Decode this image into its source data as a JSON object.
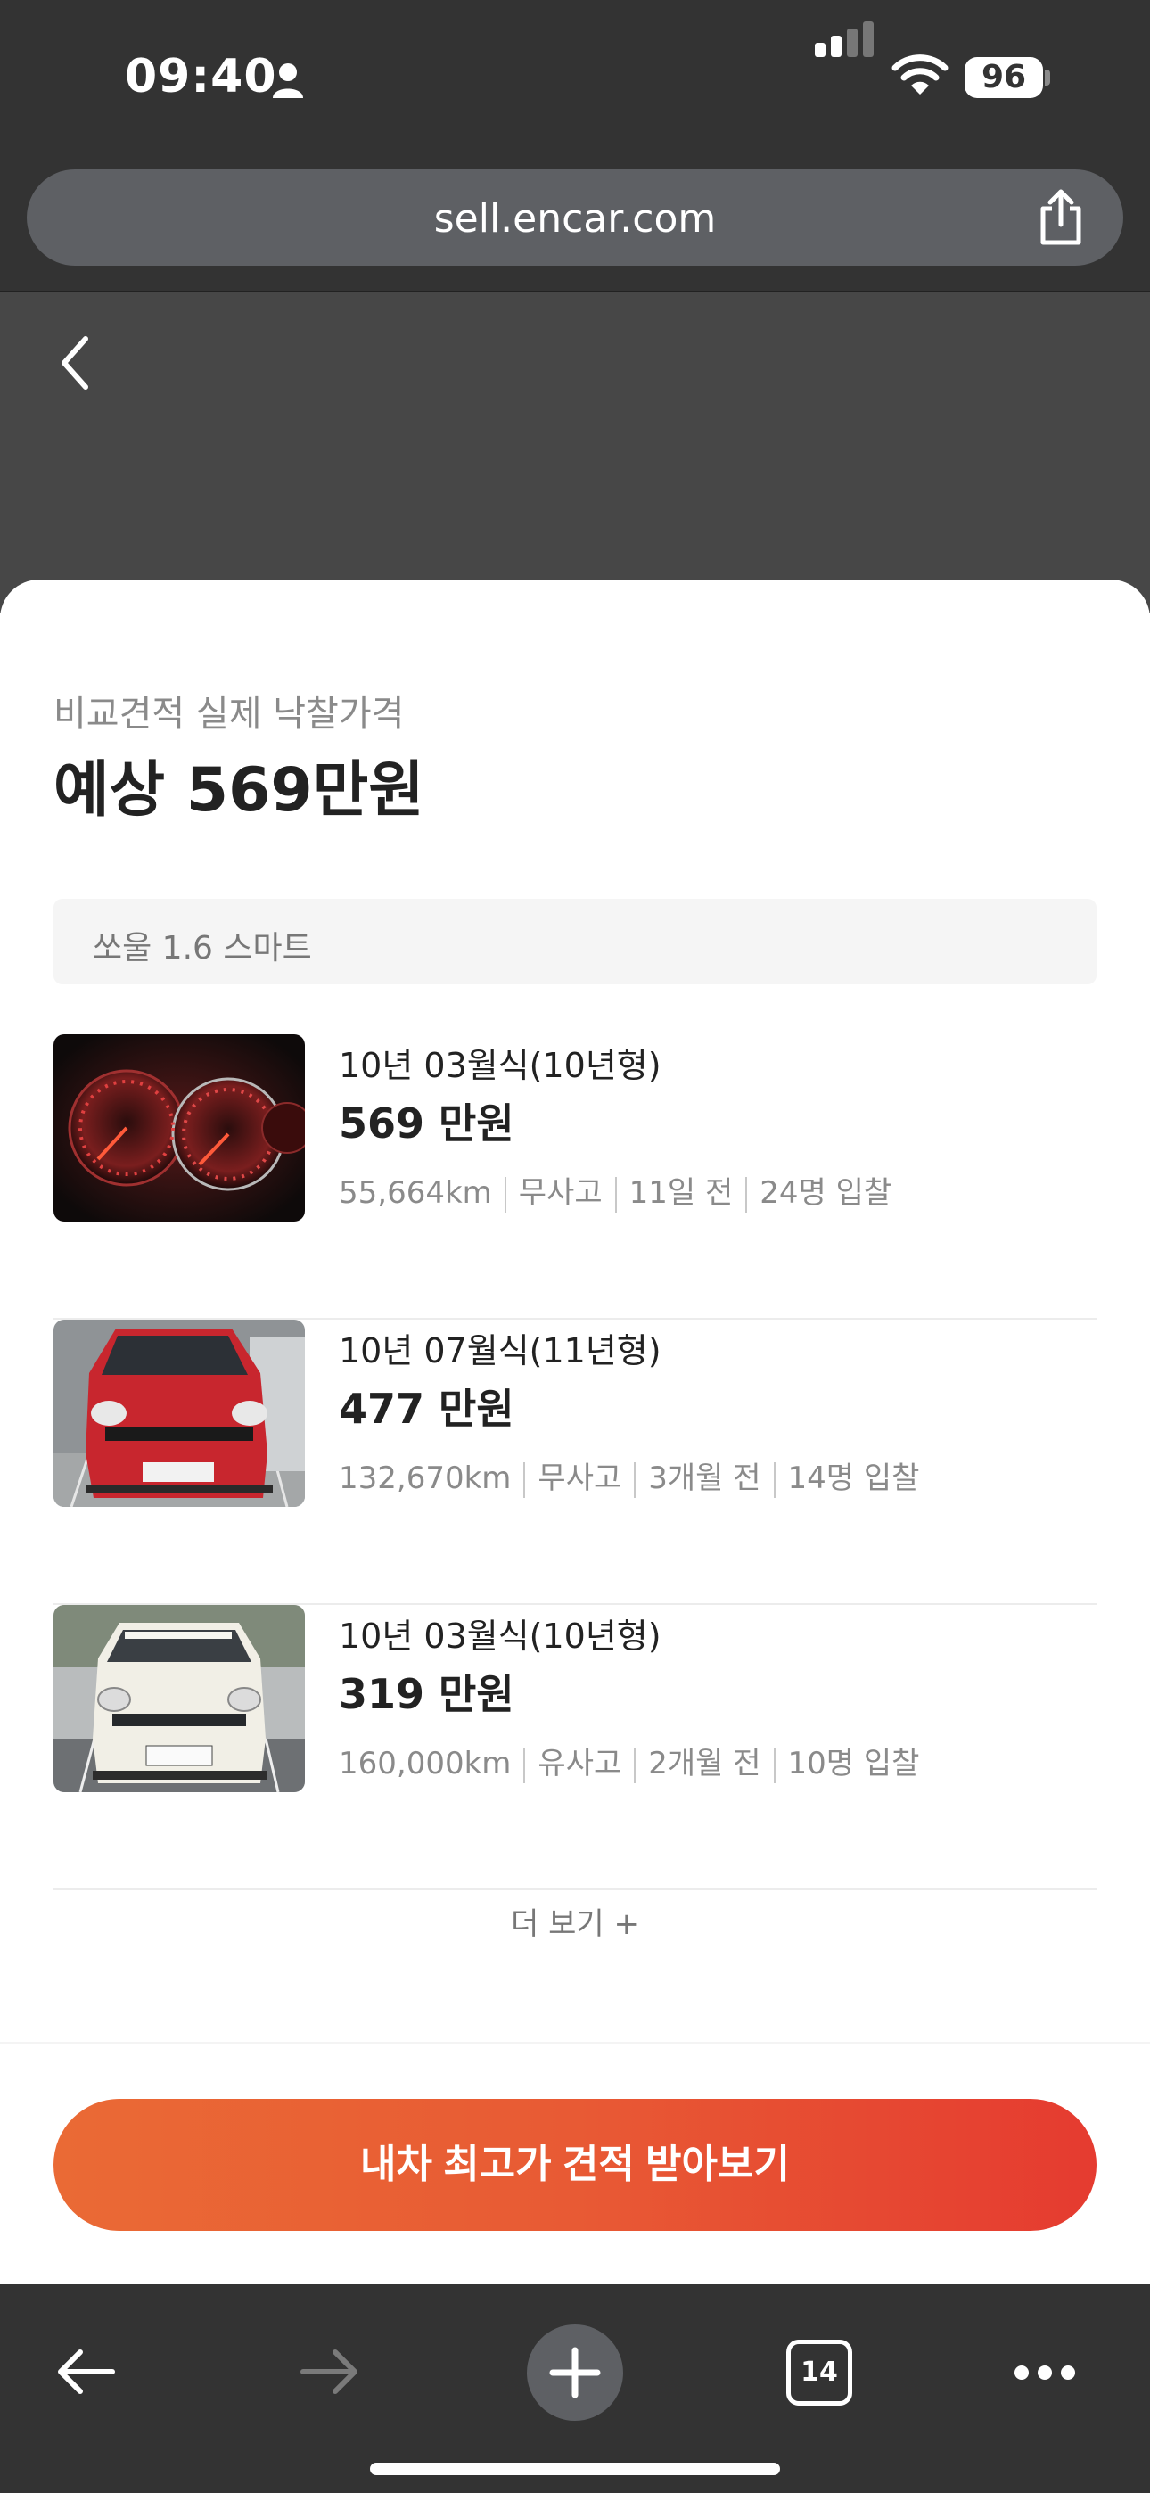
{
  "status_bar": {
    "time": "09:40",
    "battery": "96",
    "icons": [
      "person-icon",
      "signal-icon",
      "wifi-icon",
      "battery-icon"
    ]
  },
  "browser": {
    "url": "sell.encar.com",
    "icons": [
      "share-icon"
    ]
  },
  "page": {
    "back_icon": "chevron-left-icon",
    "subtitle": "비교견적 실제 낙찰가격",
    "headline": "예상 569만원",
    "model": "쏘울 1.6 스마트",
    "cars": [
      {
        "date": "10년 03월식(10년형)",
        "price": "569 만원",
        "mileage": "55,664km",
        "accident": "무사고",
        "ago": "11일 전",
        "bids": "24명 입찰",
        "thumbnail": "dashboard-gauges-photo"
      },
      {
        "date": "10년 07월식(11년형)",
        "price": "477 만원",
        "mileage": "132,670km",
        "accident": "무사고",
        "ago": "3개월 전",
        "bids": "14명 입찰",
        "thumbnail": "red-car-front-photo"
      },
      {
        "date": "10년 03월식(10년형)",
        "price": "319 만원",
        "mileage": "160,000km",
        "accident": "유사고",
        "ago": "2개월 전",
        "bids": "10명 입찰",
        "thumbnail": "white-car-front-photo"
      }
    ],
    "more_label": "더 보기 +",
    "cta_label": "내차 최고가 견적 받아보기"
  },
  "toolbar": {
    "tabs_count": "14",
    "icons": [
      "back-arrow-icon",
      "forward-arrow-icon",
      "new-tab-plus-icon",
      "tabs-icon",
      "more-icon"
    ]
  },
  "colors": {
    "chrome_dark": "#333333",
    "cta_start": "#ea6a35",
    "cta_end": "#e53b30",
    "text_primary": "#222222",
    "text_secondary": "#8a8a8a"
  }
}
